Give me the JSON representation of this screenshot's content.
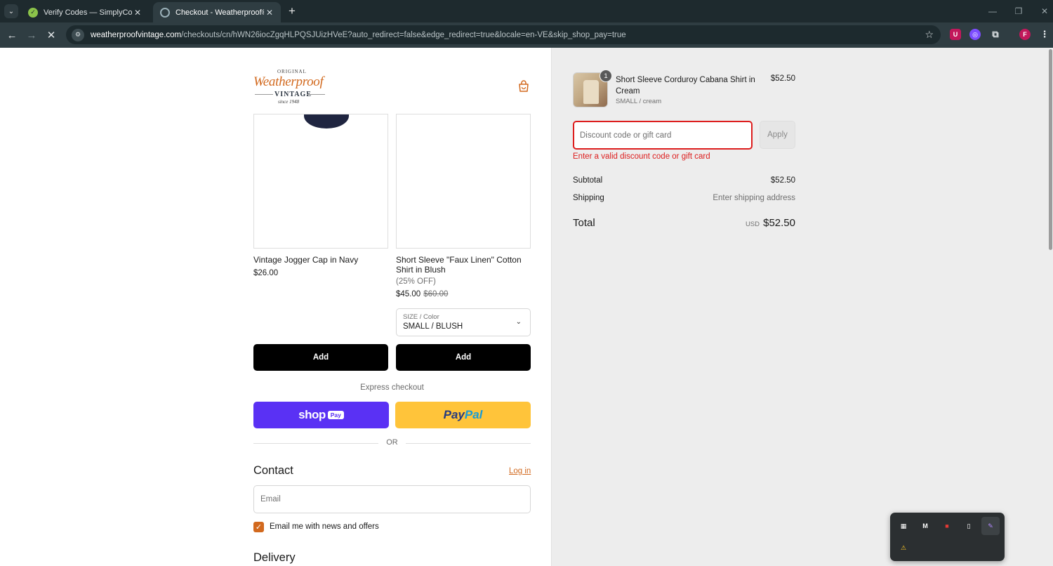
{
  "browser": {
    "tabs": [
      {
        "title": "Verify Codes — SimplyCodes",
        "favicon": "simplycodes-icon",
        "active": false
      },
      {
        "title": "Checkout - Weatherproof® Vin",
        "favicon": "loading-spinner-icon",
        "active": true
      }
    ],
    "url_host": "weatherproofvintage.com",
    "url_path": "/checkouts/cn/hWN26iocZgqHLPQSJUizHVeE?auto_redirect=false&edge_redirect=true&locale=en-VE&skip_shop_pay=true",
    "profile_initial": "F"
  },
  "logo": {
    "top": "ORIGINAL",
    "script": "Weatherproof",
    "middle": "VINTAGE",
    "bottom": "since 1948"
  },
  "upsell": [
    {
      "name": "Vintage Jogger Cap in Navy",
      "price": "$26.00",
      "button": "Add"
    },
    {
      "name": "Short Sleeve \"Faux Linen\" Cotton Shirt in Blush",
      "discount": "(25% OFF)",
      "price": "$45.00",
      "compare_price": "$60.00",
      "select_label": "SIZE / Color",
      "select_value": "SMALL / BLUSH",
      "button": "Add"
    }
  ],
  "express": {
    "heading": "Express checkout",
    "shoppay_word": "shop",
    "shoppay_badge": "Pay",
    "paypal_1": "Pay",
    "paypal_2": "Pal",
    "or": "OR"
  },
  "contact": {
    "title": "Contact",
    "login": "Log in",
    "email_placeholder": "Email",
    "newsletter_label": "Email me with news and offers",
    "newsletter_checked": true
  },
  "delivery": {
    "title": "Delivery"
  },
  "summary": {
    "item": {
      "name": "Short Sleeve Corduroy Cabana Shirt in Cream",
      "variant": "SMALL / cream",
      "price": "$52.50",
      "quantity": "1"
    },
    "discount_placeholder": "Discount code or gift card",
    "apply": "Apply",
    "error": "Enter a valid discount code or gift card",
    "subtotal_label": "Subtotal",
    "subtotal_value": "$52.50",
    "shipping_label": "Shipping",
    "shipping_value": "Enter shipping address",
    "total_label": "Total",
    "total_currency": "USD",
    "total_value": "$52.50"
  },
  "colors": {
    "accent": "#d2691e",
    "error": "#dd1d1d",
    "shoppay": "#5a31f4",
    "paypal": "#ffc43a"
  }
}
